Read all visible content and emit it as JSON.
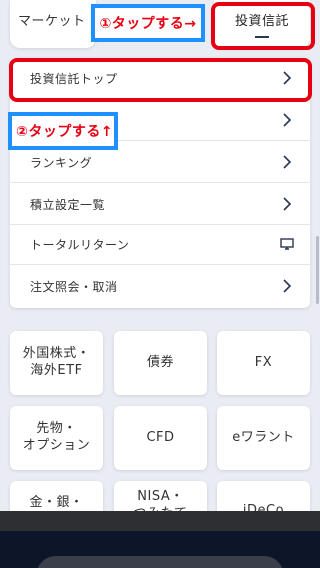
{
  "tabs": {
    "market_label": "マーケット",
    "fund_label": "投資信託"
  },
  "annotations": {
    "step1": "①タップする→",
    "step2": "②タップする↑"
  },
  "menu": {
    "items": [
      {
        "label": "投資信託トップ",
        "icon": "chevron-right-icon"
      },
      {
        "label": "",
        "icon": "chevron-right-icon"
      },
      {
        "label": "ランキング",
        "icon": "chevron-right-icon"
      },
      {
        "label": "積立設定一覧",
        "icon": "chevron-right-icon"
      },
      {
        "label": "トータルリターン",
        "icon": "monitor-icon"
      },
      {
        "label": "注文照会・取消",
        "icon": "chevron-right-icon"
      }
    ]
  },
  "tiles": [
    {
      "label": "外国株式・\n海外ETF"
    },
    {
      "label": "債券"
    },
    {
      "label": "FX"
    },
    {
      "label": "先物・\nオプション"
    },
    {
      "label": "CFD"
    },
    {
      "label": "eワラント"
    },
    {
      "label": "金・銀・"
    },
    {
      "label": "NISA・\nつみたて"
    },
    {
      "label": "iDeCo"
    }
  ],
  "colors": {
    "annotation_red": "#e60012",
    "annotation_blue": "#1e90ff",
    "background": "#e9ecf3"
  }
}
